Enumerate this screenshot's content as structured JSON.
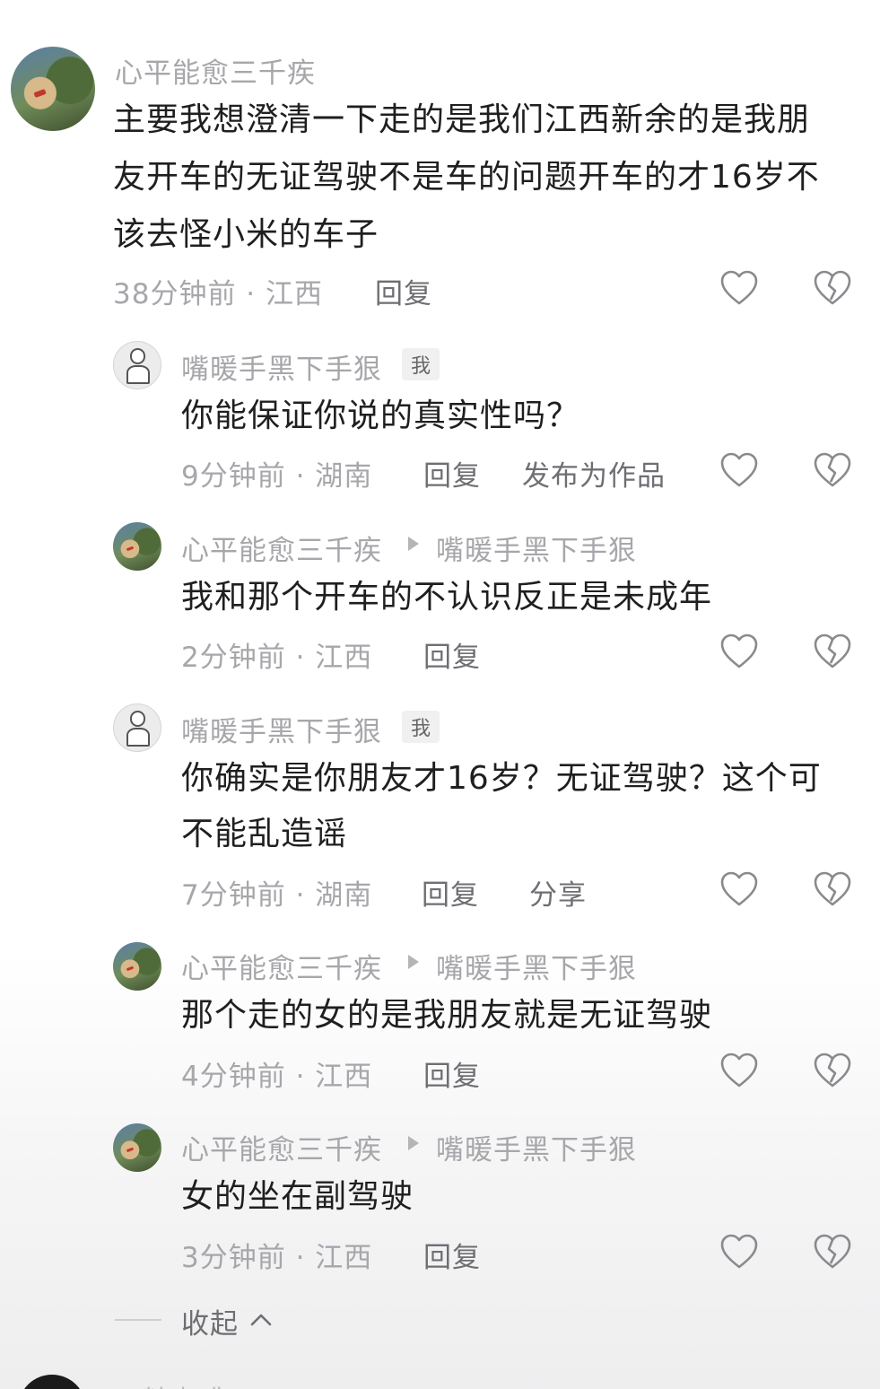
{
  "comments": [
    {
      "author": "心平能愈三千疾",
      "text_lines": [
        "主要我想澄清一下走的是我们江西新余的是我朋",
        "友开车的无证驾驶不是车的问题开车的才16岁不",
        "该去怪小米的车子"
      ],
      "meta": "38分钟前 · 江西",
      "reply_label": "回复"
    },
    {
      "author": "嘴暖手黑下手狠",
      "me_tag": "我",
      "text_lines": [
        "你能保证你说的真实性吗？"
      ],
      "meta": "9分钟前 · 湖南",
      "reply_label": "回复",
      "extra_label": "发布为作品"
    },
    {
      "author": "心平能愈三千疾",
      "reply_to": "嘴暖手黑下手狠",
      "text_lines": [
        "我和那个开车的不认识反正是未成年"
      ],
      "meta": "2分钟前 · 江西",
      "reply_label": "回复"
    },
    {
      "author": "嘴暖手黑下手狠",
      "me_tag": "我",
      "text_lines": [
        "你确实是你朋友才16岁？无证驾驶？这个可",
        "不能乱造谣"
      ],
      "meta": "7分钟前 · 湖南",
      "reply_label": "回复",
      "extra_label": "分享"
    },
    {
      "author": "心平能愈三千疾",
      "reply_to": "嘴暖手黑下手狠",
      "text_lines": [
        "那个走的女的是我朋友就是无证驾驶"
      ],
      "meta": "4分钟前 · 江西",
      "reply_label": "回复"
    },
    {
      "author": "心平能愈三千疾",
      "reply_to": "嘴暖手黑下手狠",
      "text_lines": [
        "女的坐在副驾驶"
      ],
      "meta": "3分钟前 · 江西",
      "reply_label": "回复"
    }
  ],
  "collapse_label": "收起",
  "next_author_partial": "石精咖啡",
  "icons": {
    "like": "heart-outline-icon",
    "dislike": "broken-heart-icon",
    "collapse": "chevron-up-icon"
  },
  "colors": {
    "secondary_text": "#a7a7ab",
    "primary_text": "#1f1f1f",
    "action_text": "#6e6e73"
  }
}
